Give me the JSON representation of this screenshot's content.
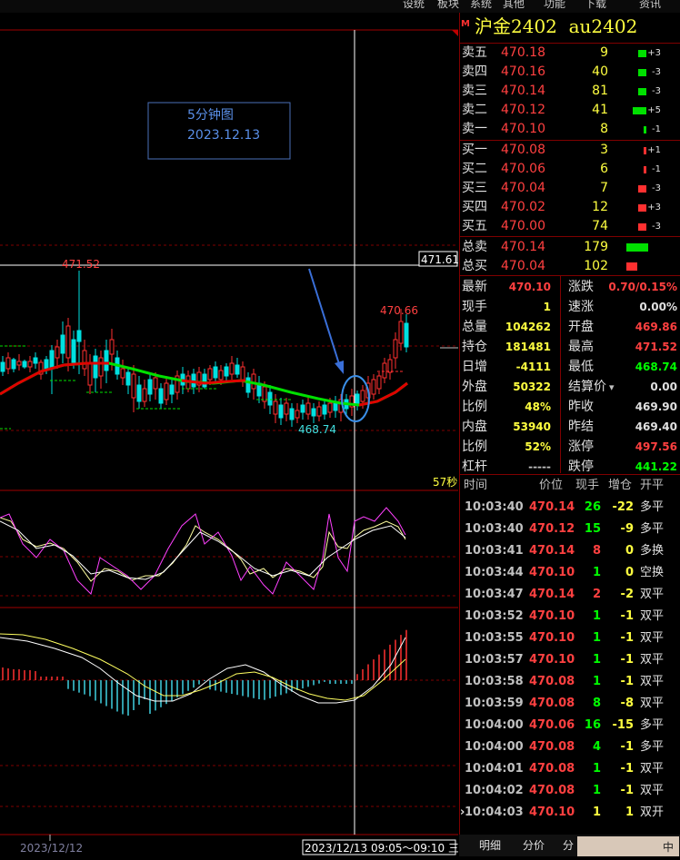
{
  "menu": {
    "items": [
      "设统",
      "板块",
      "系统",
      "其他",
      "功能",
      "下载",
      "资讯"
    ]
  },
  "instrument": {
    "title": "沪金2402  au2402",
    "badge": "M"
  },
  "chart": {
    "annotation_line1": "5分钟图",
    "annotation_line2": "2023.12.13",
    "price_high_marker": "471.52",
    "price_low_marker": "468.74",
    "price_last_marker": "470.66",
    "crosshair_price": "471.61",
    "countdown": "57秒",
    "xaxis_left_date": "2023/12/12",
    "xaxis_cross_time": "2023/12/13 09:05～09:10 三"
  },
  "orderbook": {
    "asks": [
      {
        "label": "卖五",
        "price": "470.18",
        "vol": "9",
        "chg": "+3"
      },
      {
        "label": "卖四",
        "price": "470.16",
        "vol": "40",
        "chg": "-3"
      },
      {
        "label": "卖三",
        "price": "470.14",
        "vol": "81",
        "chg": "-3"
      },
      {
        "label": "卖二",
        "price": "470.12",
        "vol": "41",
        "chg": "+5"
      },
      {
        "label": "卖一",
        "price": "470.10",
        "vol": "8",
        "chg": "-1"
      }
    ],
    "bids": [
      {
        "label": "买一",
        "price": "470.08",
        "vol": "3",
        "chg": "+1"
      },
      {
        "label": "买二",
        "price": "470.06",
        "vol": "6",
        "chg": "-1"
      },
      {
        "label": "买三",
        "price": "470.04",
        "vol": "7",
        "chg": "-3"
      },
      {
        "label": "买四",
        "price": "470.02",
        "vol": "12",
        "chg": "+3"
      },
      {
        "label": "买五",
        "price": "470.00",
        "vol": "74",
        "chg": "-3"
      }
    ],
    "total_ask": {
      "label": "总卖",
      "price": "470.14",
      "vol": "179"
    },
    "total_bid": {
      "label": "总买",
      "price": "470.04",
      "vol": "102"
    }
  },
  "stats": {
    "left": [
      {
        "label": "最新",
        "value": "470.10"
      },
      {
        "label": "现手",
        "value": "1"
      },
      {
        "label": "总量",
        "value": "104262"
      },
      {
        "label": "持仓",
        "value": "181481"
      },
      {
        "label": "日增",
        "value": "-4111"
      },
      {
        "label": "外盘",
        "value": "50322"
      },
      {
        "label": "比例",
        "value": "48%"
      },
      {
        "label": "内盘",
        "value": "53940"
      },
      {
        "label": "比例",
        "value": "52%"
      },
      {
        "label": "杠杆",
        "value": "-----"
      }
    ],
    "right": [
      {
        "label": "涨跌",
        "value": "0.70/0.15%"
      },
      {
        "label": "速涨",
        "value": "0.00%"
      },
      {
        "label": "开盘",
        "value": "469.86"
      },
      {
        "label": "最高",
        "value": "471.52"
      },
      {
        "label": "最低",
        "value": "468.74"
      },
      {
        "label": "结算价",
        "value": "0.00"
      },
      {
        "label": "昨收",
        "value": "469.90"
      },
      {
        "label": "昨结",
        "value": "469.40"
      },
      {
        "label": "涨停",
        "value": "497.56"
      },
      {
        "label": "跌停",
        "value": "441.22"
      }
    ]
  },
  "ticks": {
    "headers": [
      "时间",
      "价位",
      "现手",
      "增仓",
      "开平"
    ],
    "rows": [
      {
        "time": "10:03:40",
        "price": "470.14",
        "vol": "26",
        "oi": "-22",
        "type": "多平"
      },
      {
        "time": "10:03:40",
        "price": "470.12",
        "vol": "15",
        "oi": "-9",
        "type": "多平"
      },
      {
        "time": "10:03:41",
        "price": "470.14",
        "vol": "8",
        "oi": "0",
        "type": "多换"
      },
      {
        "time": "10:03:44",
        "price": "470.10",
        "vol": "1",
        "oi": "0",
        "type": "空换"
      },
      {
        "time": "10:03:47",
        "price": "470.14",
        "vol": "2",
        "oi": "-2",
        "type": "双平"
      },
      {
        "time": "10:03:52",
        "price": "470.10",
        "vol": "1",
        "oi": "-1",
        "type": "双平"
      },
      {
        "time": "10:03:55",
        "price": "470.10",
        "vol": "1",
        "oi": "-1",
        "type": "双平"
      },
      {
        "time": "10:03:57",
        "price": "470.10",
        "vol": "1",
        "oi": "-1",
        "type": "双平"
      },
      {
        "time": "10:03:58",
        "price": "470.08",
        "vol": "1",
        "oi": "-1",
        "type": "双平"
      },
      {
        "time": "10:03:59",
        "price": "470.08",
        "vol": "8",
        "oi": "-8",
        "type": "双平"
      },
      {
        "time": "10:04:00",
        "price": "470.06",
        "vol": "16",
        "oi": "-15",
        "type": "多平"
      },
      {
        "time": "10:04:00",
        "price": "470.08",
        "vol": "4",
        "oi": "-1",
        "type": "多平"
      },
      {
        "time": "10:04:01",
        "price": "470.08",
        "vol": "1",
        "oi": "-1",
        "type": "双平"
      },
      {
        "time": "10:04:02",
        "price": "470.08",
        "vol": "1",
        "oi": "-1",
        "type": "双平"
      },
      {
        "time": "10:04:03",
        "price": "470.10",
        "vol": "1",
        "oi": "1",
        "type": "双开"
      }
    ]
  },
  "tabs": [
    "明细",
    "分价",
    "分"
  ],
  "ime": {
    "label": "中"
  },
  "colors": {
    "up": "#ff3030",
    "down": "#00e0e0",
    "ma_up": "#e00000",
    "ma_down": "#00e000",
    "bg": "#000000",
    "frame": "#800000"
  }
}
